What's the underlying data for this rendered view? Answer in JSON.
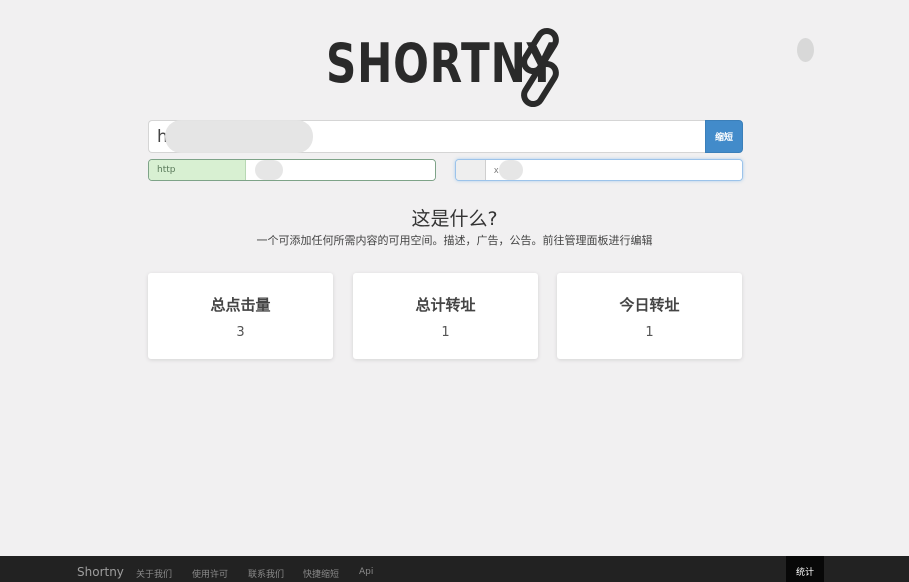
{
  "logo": {
    "text": "SHORTNY"
  },
  "shorten": {
    "url_value": "h",
    "button_label": "缩短"
  },
  "options": {
    "left_addon": "http",
    "right_field": "x"
  },
  "about": {
    "title": "这是什么?",
    "description": "一个可添加任何所需内容的可用空间。描述，广告，公告。前往管理面板进行编辑"
  },
  "stats": [
    {
      "label": "总点击量",
      "value": "3"
    },
    {
      "label": "总计转址",
      "value": "1"
    },
    {
      "label": "今日转址",
      "value": "1"
    }
  ],
  "footer": {
    "brand": "Shortny",
    "links": [
      "关于我们",
      "使用许可",
      "联系我们",
      "快捷缩短",
      "Api"
    ],
    "stats_label": "统计"
  },
  "colors": {
    "accent": "#428bca",
    "footer_bg": "#222222",
    "page_bg": "#f1f0f1"
  }
}
